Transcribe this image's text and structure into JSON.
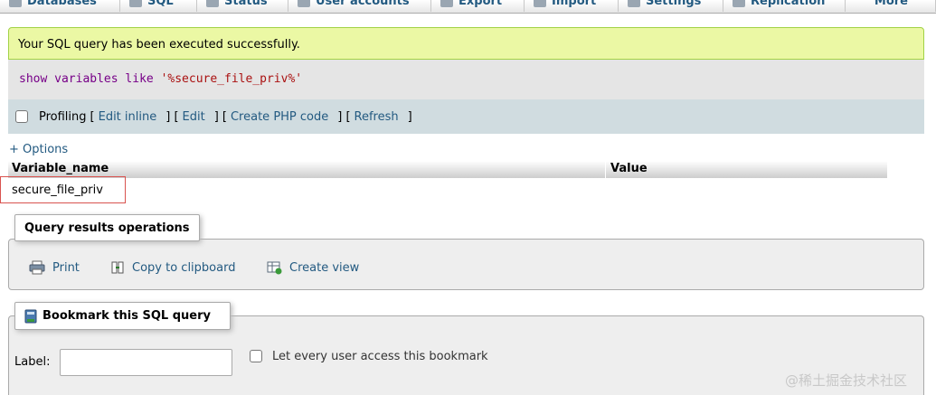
{
  "tabs": [
    {
      "label": "Databases",
      "icon": "database-icon"
    },
    {
      "label": "SQL",
      "icon": "sql-icon"
    },
    {
      "label": "Status",
      "icon": "status-chart-icon"
    },
    {
      "label": "User accounts",
      "icon": "users-icon"
    },
    {
      "label": "Export",
      "icon": "export-icon"
    },
    {
      "label": "Import",
      "icon": "import-icon"
    },
    {
      "label": "Settings",
      "icon": "wrench-icon"
    },
    {
      "label": "Replication",
      "icon": "replication-icon"
    },
    {
      "label": "More",
      "icon": "chevron-down-icon"
    }
  ],
  "message": {
    "success_text": "Your SQL query has been executed successfully."
  },
  "query": {
    "kw1": "show",
    "kw2": "variables",
    "kw3": "like",
    "str": "'%secure_file_priv%'"
  },
  "query_tools": {
    "profiling_label": "Profiling",
    "links": [
      "Edit inline",
      "Edit",
      "Create PHP code",
      "Refresh"
    ]
  },
  "options_link": "+ Options",
  "results": {
    "columns": [
      "Variable_name",
      "Value"
    ],
    "rows": [
      [
        "secure_file_priv",
        ""
      ]
    ]
  },
  "query_ops": {
    "legend": "Query results operations",
    "print": "Print",
    "copy": "Copy to clipboard",
    "create_view": "Create view"
  },
  "bookmark": {
    "legend": "Bookmark this SQL query",
    "label_text": "Label:",
    "label_value": "",
    "share_text": "Let every user access this bookmark"
  },
  "watermark": "@稀土掘金技术社区",
  "colors": {
    "success_bg": "#ebf8a4",
    "link": "#235a81",
    "highlight_border": "#d9534f"
  }
}
